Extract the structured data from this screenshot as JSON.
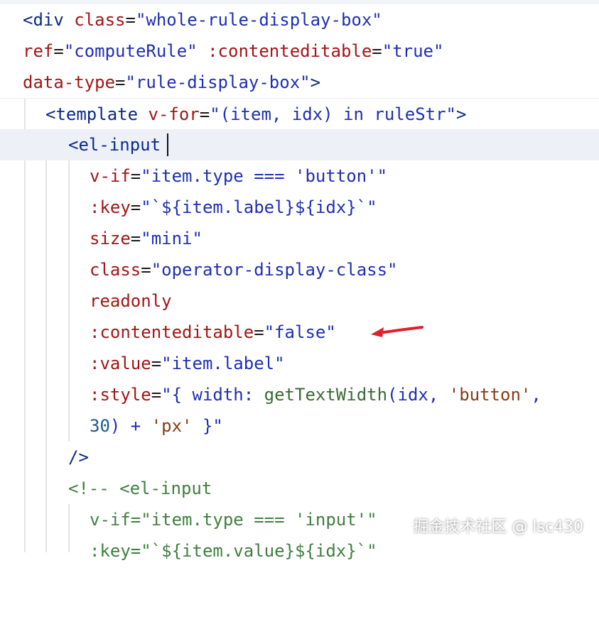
{
  "editor": {
    "lines": [
      {
        "id": "l1",
        "segs": [
          [
            "tag",
            "<div "
          ],
          [
            "attr",
            "class"
          ],
          [
            "eq",
            "="
          ],
          [
            "val",
            "\"whole-rule-display-box\""
          ]
        ]
      },
      {
        "id": "l2",
        "segs": [
          [
            "attr",
            "ref"
          ],
          [
            "eq",
            "="
          ],
          [
            "val",
            "\"computeRule\" "
          ],
          [
            "attr",
            ":contenteditable"
          ],
          [
            "eq",
            "="
          ],
          [
            "val",
            "\"true\""
          ]
        ]
      },
      {
        "id": "l3",
        "segs": [
          [
            "attr",
            "data-type"
          ],
          [
            "eq",
            "="
          ],
          [
            "val",
            "\"rule-display-box\""
          ],
          [
            "tag",
            ">"
          ]
        ]
      },
      {
        "id": "l4",
        "segs": [
          [
            "tag",
            "<template "
          ],
          [
            "attr",
            "v-for"
          ],
          [
            "eq",
            "="
          ],
          [
            "val",
            "\"(item, idx) in ruleStr\""
          ],
          [
            "tag",
            ">"
          ]
        ]
      },
      {
        "id": "l5",
        "segs": [
          [
            "tag",
            "<el-input"
          ]
        ]
      },
      {
        "id": "l6",
        "segs": [
          [
            "attr",
            "v-if"
          ],
          [
            "eq",
            "="
          ],
          [
            "val",
            "\"item.type === 'button'\""
          ]
        ]
      },
      {
        "id": "l7",
        "segs": [
          [
            "attr",
            ":key"
          ],
          [
            "eq",
            "="
          ],
          [
            "val",
            "\"`${item.label}${idx}`\""
          ]
        ]
      },
      {
        "id": "l8",
        "segs": [
          [
            "attr",
            "size"
          ],
          [
            "eq",
            "="
          ],
          [
            "val",
            "\"mini\""
          ]
        ]
      },
      {
        "id": "l9",
        "segs": [
          [
            "attr",
            "class"
          ],
          [
            "eq",
            "="
          ],
          [
            "val",
            "\"operator-display-class\""
          ]
        ]
      },
      {
        "id": "l10",
        "segs": [
          [
            "attr",
            "readonly"
          ]
        ]
      },
      {
        "id": "l11",
        "segs": [
          [
            "attr",
            ":contenteditable"
          ],
          [
            "eq",
            "="
          ],
          [
            "val",
            "\"false\""
          ]
        ]
      },
      {
        "id": "l12",
        "segs": [
          [
            "attr",
            ":value"
          ],
          [
            "eq",
            "="
          ],
          [
            "val",
            "\"item.label\""
          ]
        ]
      },
      {
        "id": "l13",
        "segs": [
          [
            "attr",
            ":style"
          ],
          [
            "eq",
            "="
          ],
          [
            "val",
            "\"{ width: "
          ],
          [
            "fn",
            "getTextWidth"
          ],
          [
            "val",
            "(idx, "
          ],
          [
            "q",
            "'button'"
          ],
          [
            "val",
            ","
          ]
        ]
      },
      {
        "id": "l14",
        "segs": [
          [
            "num",
            "30"
          ],
          [
            "val",
            ") + "
          ],
          [
            "q",
            "'px'"
          ],
          [
            "val",
            " }\""
          ]
        ]
      },
      {
        "id": "l15",
        "segs": [
          [
            "tag",
            "/>"
          ]
        ]
      },
      {
        "id": "l16",
        "segs": [
          [
            "cm",
            "<!-- <el-input"
          ]
        ]
      },
      {
        "id": "l17",
        "segs": [
          [
            "cm",
            "v-if=\"item.type === 'input'\""
          ]
        ]
      },
      {
        "id": "l18",
        "segs": [
          [
            "cm",
            ":key=\"`${item.value}${idx}`\""
          ]
        ]
      }
    ]
  },
  "watermark": "掘金技术社区 @ lsc430",
  "annotation": {
    "color": "#e0202a"
  }
}
